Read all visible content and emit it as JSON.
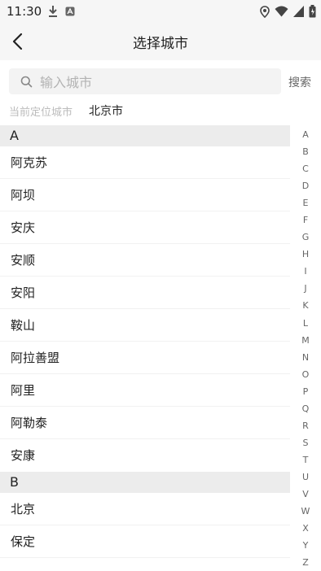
{
  "status_bar": {
    "time": "11:30",
    "left_icons": [
      "download-icon",
      "app-notification-icon"
    ],
    "right_icons": [
      "location-icon",
      "wifi-icon",
      "signal-icon",
      "battery-icon"
    ]
  },
  "header": {
    "back_icon": "chevron-left-icon",
    "title": "选择城市"
  },
  "search": {
    "placeholder": "输入城市",
    "value": "",
    "button_label": "搜索"
  },
  "location": {
    "label": "当前定位城市",
    "city": "北京市"
  },
  "sections": [
    {
      "letter": "A",
      "cities": [
        "阿克苏",
        "阿坝",
        "安庆",
        "安顺",
        "安阳",
        "鞍山",
        "阿拉善盟",
        "阿里",
        "阿勒泰",
        "安康"
      ]
    },
    {
      "letter": "B",
      "cities": [
        "北京",
        "保定"
      ]
    }
  ],
  "index_letters": [
    "A",
    "B",
    "C",
    "D",
    "E",
    "F",
    "G",
    "H",
    "I",
    "J",
    "K",
    "L",
    "M",
    "N",
    "O",
    "P",
    "Q",
    "R",
    "S",
    "T",
    "U",
    "V",
    "W",
    "X",
    "Y",
    "Z"
  ],
  "colors": {
    "header_bg": "#f6f6f6",
    "section_bg": "#ececec",
    "placeholder": "#b3b3b3",
    "muted_label": "#bcbcbc"
  }
}
